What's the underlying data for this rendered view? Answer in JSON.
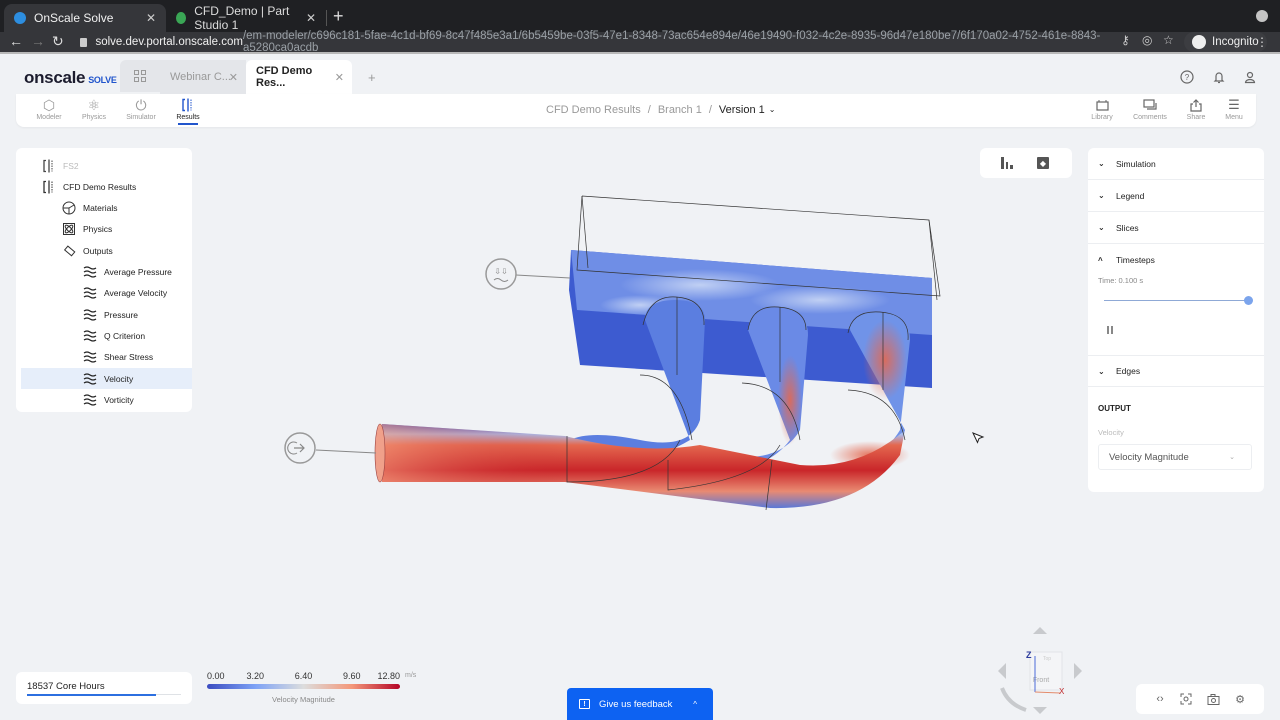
{
  "browser": {
    "tabs": [
      {
        "title": "OnScale Solve",
        "active": true,
        "favicon_color": "#2d8ee0"
      },
      {
        "title": "CFD_Demo | Part Studio 1",
        "active": false,
        "favicon_color": "#3aa655"
      }
    ],
    "url_host": "solve.dev.portal.onscale.com",
    "url_path": "/em-modeler/c696c181-5fae-4c1d-bf69-8c47f485e3a1/6b5459be-03f5-47e1-8348-73ac654e894e/46e19490-f032-4c2e-8935-96d47e180be7/6f170a02-4752-461e-8843-a5280ca0acdb",
    "profile_label": "Incognito"
  },
  "app": {
    "logo_main": "onscale",
    "logo_sub": "SOLVE",
    "tabs": [
      {
        "label": "Webinar C...",
        "active": false
      },
      {
        "label": "CFD Demo Res...",
        "active": true
      }
    ],
    "header_icons": [
      "help-icon",
      "bell-icon",
      "user-icon"
    ]
  },
  "toolbar": {
    "tools": [
      {
        "label": "Modeler",
        "icon": "cube-icon",
        "active": false
      },
      {
        "label": "Physics",
        "icon": "atom-icon",
        "active": false
      },
      {
        "label": "Simulator",
        "icon": "power-icon",
        "active": false
      },
      {
        "label": "Results",
        "icon": "results-icon",
        "active": true
      }
    ],
    "breadcrumb": [
      "CFD Demo Results",
      "Branch 1",
      "Version 1"
    ],
    "right_tools": [
      {
        "label": "Library",
        "icon": "library-icon"
      },
      {
        "label": "Comments",
        "icon": "comments-icon"
      },
      {
        "label": "Share",
        "icon": "share-icon"
      },
      {
        "label": "Menu",
        "icon": "menu-icon"
      }
    ]
  },
  "tree": {
    "items": [
      {
        "label": "FS2",
        "level": 0,
        "icon": "results-icon",
        "muted": true
      },
      {
        "label": "CFD Demo Results",
        "level": 0,
        "icon": "results-icon"
      },
      {
        "label": "Materials",
        "level": 1,
        "icon": "globe-icon"
      },
      {
        "label": "Physics",
        "level": 1,
        "icon": "atom-icon"
      },
      {
        "label": "Outputs",
        "level": 1,
        "icon": "tag-icon"
      },
      {
        "label": "Average Pressure",
        "level": 2,
        "icon": "waves-icon"
      },
      {
        "label": "Average Velocity",
        "level": 2,
        "icon": "waves-icon"
      },
      {
        "label": "Pressure",
        "level": 2,
        "icon": "waves-icon"
      },
      {
        "label": "Q Criterion",
        "level": 2,
        "icon": "waves-icon"
      },
      {
        "label": "Shear Stress",
        "level": 2,
        "icon": "waves-icon"
      },
      {
        "label": "Velocity",
        "level": 2,
        "icon": "waves-icon",
        "selected": true
      },
      {
        "label": "Vorticity",
        "level": 2,
        "icon": "waves-icon"
      }
    ]
  },
  "right_panel": {
    "sections": [
      {
        "label": "Simulation",
        "expanded": false
      },
      {
        "label": "Legend",
        "expanded": false
      },
      {
        "label": "Slices",
        "expanded": false
      },
      {
        "label": "Timesteps",
        "expanded": true
      },
      {
        "label": "Edges",
        "expanded": false
      }
    ],
    "time_label": "Time: 0.100 s",
    "timestep_progress": 1.0,
    "output_heading": "OUTPUT",
    "output_field_label": "Velocity",
    "output_select_value": "Velocity Magnitude"
  },
  "core_hours": {
    "text": "18537 Core Hours",
    "usage_fraction": 0.84
  },
  "colorbar": {
    "ticks": [
      "0.00",
      "3.20",
      "6.40",
      "9.60",
      "12.80"
    ],
    "unit": "m/s",
    "title": "Velocity Magnitude",
    "min": 0.0,
    "max": 12.8,
    "colors": [
      "#3b4cc0",
      "#7da2f6",
      "#dcdddd",
      "#f4987a",
      "#b40426"
    ]
  },
  "feedback": {
    "label": "Give us feedback"
  },
  "navcube": {
    "axis_z": "Z",
    "axis_x": "X",
    "face_front": "Front",
    "face_top": "Top"
  },
  "bottom_tools": [
    "code-icon",
    "focus-icon",
    "camera-icon",
    "settings-icon"
  ]
}
